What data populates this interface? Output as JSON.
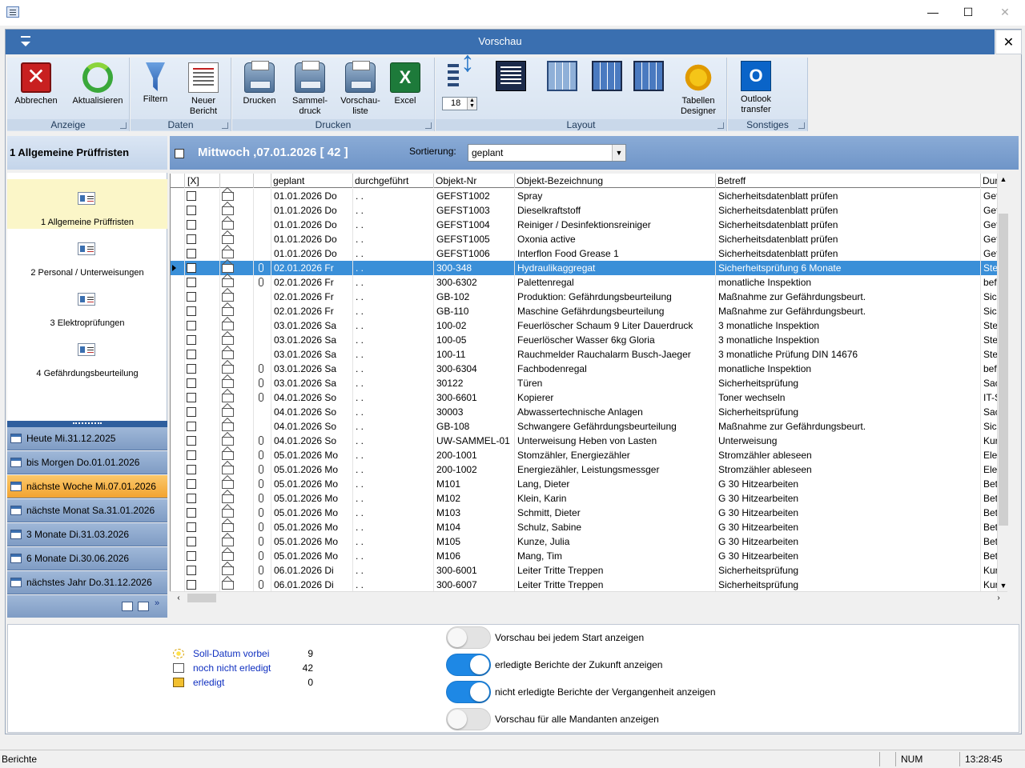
{
  "window": {
    "minimize": "—",
    "maximize": "☐",
    "close": "✕"
  },
  "inner": {
    "title": "Vorschau",
    "close": "✕"
  },
  "ribbon": {
    "groups": {
      "anzeige": "Anzeige",
      "daten": "Daten",
      "drucken": "Drucken",
      "layout": "Layout",
      "sonstiges": "Sonstiges"
    },
    "abbrechen": "Abbrechen",
    "aktualisieren": "Aktualisieren",
    "filtern": "Filtern",
    "neuer_bericht_1": "Neuer",
    "neuer_bericht_2": "Bericht",
    "drucken": "Drucken",
    "sammel_1": "Sammel-",
    "sammel_2": "druck",
    "vorschau_1": "Vorschau-",
    "vorschau_2": "liste",
    "excel": "Excel",
    "font_size": "18",
    "tabellen_1": "Tabellen",
    "tabellen_2": "Designer",
    "outlook_1": "Outlook",
    "outlook_2": "transfer"
  },
  "left": {
    "header": "1 Allgemeine Prüffristen",
    "nav": [
      "1 Allgemeine Prüffristen",
      "2 Personal / Unterweisungen",
      "3 Elektroprüfungen",
      "4 Gefährdungsbeurteilung"
    ],
    "periods": [
      "Heute Mi.31.12.2025",
      "bis Morgen Do.01.01.2026",
      "nächste Woche Mi.07.01.2026",
      "nächste Monat Sa.31.01.2026",
      "3 Monate Di.31.03.2026",
      "6 Monate Di.30.06.2026",
      "nächstes Jahr Do.31.12.2026"
    ],
    "selected_period_index": 2
  },
  "grid": {
    "title": "Mittwoch ,07.01.2026  [ 42 ]",
    "sort_label": "Sortierung:",
    "sort_value": "geplant",
    "columns": [
      "[X]",
      "geplant",
      "durchgeführt",
      "Objekt-Nr",
      "Objekt-Bezeichnung",
      "Betreff",
      "Dur"
    ],
    "selected_row_index": 5,
    "rows": [
      {
        "clip": false,
        "geplant": "01.01.2026 Do",
        "durch": ". .",
        "nr": "GEFST1002",
        "bez": "Spray",
        "betreff": "Sicherheitsdatenblatt prüfen",
        "dur": "Gef"
      },
      {
        "clip": false,
        "geplant": "01.01.2026 Do",
        "durch": ". .",
        "nr": "GEFST1003",
        "bez": "Dieselkraftstoff",
        "betreff": "Sicherheitsdatenblatt prüfen",
        "dur": "Gef"
      },
      {
        "clip": false,
        "geplant": "01.01.2026 Do",
        "durch": ". .",
        "nr": "GEFST1004",
        "bez": "Reiniger / Desinfektionsreiniger",
        "betreff": "Sicherheitsdatenblatt prüfen",
        "dur": "Gef"
      },
      {
        "clip": false,
        "geplant": "01.01.2026 Do",
        "durch": ". .",
        "nr": "GEFST1005",
        "bez": "Oxonia active",
        "betreff": "Sicherheitsdatenblatt prüfen",
        "dur": "Gef"
      },
      {
        "clip": false,
        "geplant": "01.01.2026 Do",
        "durch": ". .",
        "nr": "GEFST1006",
        "bez": "Interflon Food Grease 1",
        "betreff": "Sicherheitsdatenblatt prüfen",
        "dur": "Gef"
      },
      {
        "clip": true,
        "geplant": "02.01.2026 Fr",
        "durch": ". .",
        "nr": "300-348",
        "bez": "Hydraulikaggregat",
        "betreff": "Sicherheitsprüfung 6 Monate",
        "dur": "Ste"
      },
      {
        "clip": true,
        "geplant": "02.01.2026 Fr",
        "durch": ". .",
        "nr": "300-6302",
        "bez": "Palettenregal",
        "betreff": "monatliche Inspektion",
        "dur": "bef"
      },
      {
        "clip": false,
        "geplant": "02.01.2026 Fr",
        "durch": ". .",
        "nr": "GB-102",
        "bez": "Produktion: Gefährdungsbeurteilung",
        "betreff": "Maßnahme zur Gefährdungsbeurt.",
        "dur": "Sic"
      },
      {
        "clip": false,
        "geplant": "02.01.2026 Fr",
        "durch": ". .",
        "nr": "GB-110",
        "bez": "Maschine Gefährdungsbeurteilung",
        "betreff": "Maßnahme zur Gefährdungsbeurt.",
        "dur": "Sic"
      },
      {
        "clip": false,
        "geplant": "03.01.2026 Sa",
        "durch": ". .",
        "nr": "100-02",
        "bez": "Feuerlöscher Schaum 9 Liter Dauerdruck",
        "betreff": "3 monatliche Inspektion",
        "dur": "Ste"
      },
      {
        "clip": false,
        "geplant": "03.01.2026 Sa",
        "durch": ". .",
        "nr": "100-05",
        "bez": "Feuerlöscher Wasser 6kg Gloria",
        "betreff": "3 monatliche Inspektion",
        "dur": "Ste"
      },
      {
        "clip": false,
        "geplant": "03.01.2026 Sa",
        "durch": ". .",
        "nr": "100-11",
        "bez": "Rauchmelder Rauchalarm Busch-Jaeger",
        "betreff": "3 monatliche Prüfung DIN 14676",
        "dur": "Ste"
      },
      {
        "clip": true,
        "geplant": "03.01.2026 Sa",
        "durch": ". .",
        "nr": "300-6304",
        "bez": "Fachbodenregal",
        "betreff": "monatliche Inspektion",
        "dur": "bef"
      },
      {
        "clip": true,
        "geplant": "03.01.2026 Sa",
        "durch": ". .",
        "nr": "30122",
        "bez": "Türen",
        "betreff": "Sicherheitsprüfung",
        "dur": "Sac"
      },
      {
        "clip": true,
        "geplant": "04.01.2026 So",
        "durch": ". .",
        "nr": "300-6601",
        "bez": "Kopierer",
        "betreff": "Toner wechseln",
        "dur": "IT-S"
      },
      {
        "clip": false,
        "geplant": "04.01.2026 So",
        "durch": ". .",
        "nr": "30003",
        "bez": "Abwassertechnische Anlagen",
        "betreff": "Sicherheitsprüfung",
        "dur": "Sac"
      },
      {
        "clip": false,
        "geplant": "04.01.2026 So",
        "durch": ". .",
        "nr": "GB-108",
        "bez": "Schwangere Gefährdungsbeurteilung",
        "betreff": "Maßnahme zur Gefährdungsbeurt.",
        "dur": "Sic"
      },
      {
        "clip": true,
        "geplant": "04.01.2026 So",
        "durch": ". .",
        "nr": "UW-SAMMEL-01",
        "bez": "Unterweisung Heben von Lasten",
        "betreff": "Unterweisung",
        "dur": "Kur"
      },
      {
        "clip": true,
        "geplant": "05.01.2026 Mo",
        "durch": ". .",
        "nr": "200-1001",
        "bez": "Stomzähler, Energiezähler",
        "betreff": "Stromzähler ableseen",
        "dur": "Ele"
      },
      {
        "clip": true,
        "geplant": "05.01.2026 Mo",
        "durch": ". .",
        "nr": "200-1002",
        "bez": "Energiezähler, Leistungsmessger",
        "betreff": "Stromzähler ableseen",
        "dur": "Ele"
      },
      {
        "clip": true,
        "geplant": "05.01.2026 Mo",
        "durch": ". .",
        "nr": "M101",
        "bez": "Lang, Dieter",
        "betreff": "G 30 Hitzearbeiten",
        "dur": "Bet"
      },
      {
        "clip": true,
        "geplant": "05.01.2026 Mo",
        "durch": ". .",
        "nr": "M102",
        "bez": "Klein, Karin",
        "betreff": "G 30 Hitzearbeiten",
        "dur": "Bet"
      },
      {
        "clip": true,
        "geplant": "05.01.2026 Mo",
        "durch": ". .",
        "nr": "M103",
        "bez": "Schmitt, Dieter",
        "betreff": "G 30 Hitzearbeiten",
        "dur": "Bet"
      },
      {
        "clip": true,
        "geplant": "05.01.2026 Mo",
        "durch": ". .",
        "nr": "M104",
        "bez": "Schulz, Sabine",
        "betreff": "G 30 Hitzearbeiten",
        "dur": "Bet"
      },
      {
        "clip": true,
        "geplant": "05.01.2026 Mo",
        "durch": ". .",
        "nr": "M105",
        "bez": "Kunze, Julia",
        "betreff": "G 30 Hitzearbeiten",
        "dur": "Bet"
      },
      {
        "clip": true,
        "geplant": "05.01.2026 Mo",
        "durch": ". .",
        "nr": "M106",
        "bez": "Mang, Tim",
        "betreff": "G 30 Hitzearbeiten",
        "dur": "Bet"
      },
      {
        "clip": true,
        "geplant": "06.01.2026 Di",
        "durch": ". .",
        "nr": "300-6001",
        "bez": "Leiter Tritte Treppen",
        "betreff": "Sicherheitsprüfung",
        "dur": "Kur"
      },
      {
        "clip": true,
        "geplant": "06.01.2026 Di",
        "durch": ". .",
        "nr": "300-6007",
        "bez": "Leiter Tritte Treppen",
        "betreff": "Sicherheitsprüfung",
        "dur": "Kur"
      }
    ]
  },
  "legend": [
    {
      "icon": "light-bulb-icon",
      "label": "Soll-Datum vorbei",
      "count": "9"
    },
    {
      "icon": "open-envelope-icon",
      "label": "noch nicht erledigt",
      "count": "42"
    },
    {
      "icon": "closed-envelope-icon",
      "label": "erledigt",
      "count": "0"
    }
  ],
  "toggles": [
    {
      "label": "Vorschau bei jedem Start anzeigen",
      "on": false
    },
    {
      "label": "erledigte Berichte der Zukunft anzeigen",
      "on": true
    },
    {
      "label": "nicht erledigte Berichte der Vergangenheit anzeigen",
      "on": true
    },
    {
      "label": "Vorschau für alle Mandanten anzeigen",
      "on": false
    }
  ],
  "status": {
    "left": "Berichte",
    "num": "NUM",
    "time": "13:28:45"
  },
  "colors": {
    "accent": "#3a6fb0",
    "selected_row": "#3a8fd8",
    "selected_period": "#f2a331",
    "toggle_on": "#1e88e5"
  }
}
